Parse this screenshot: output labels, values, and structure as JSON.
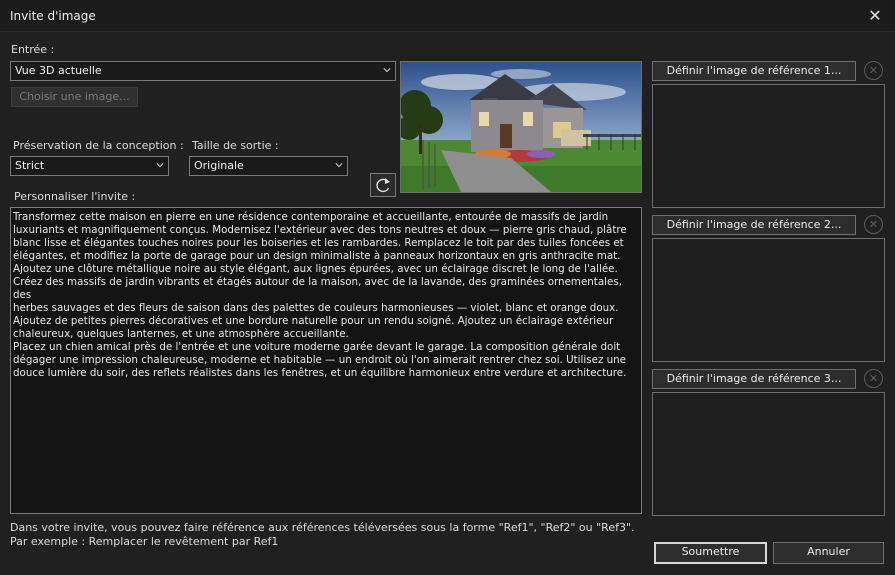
{
  "window": {
    "title": "Invite d'image",
    "close_glyph": "✕"
  },
  "input": {
    "label": "Entrée :",
    "source_value": "Vue 3D actuelle",
    "choose_image_label": "Choisir une image..."
  },
  "design_preservation": {
    "label": "Préservation de la conception :",
    "value": "Strict"
  },
  "output_size": {
    "label": "Taille de sortie :",
    "value": "Originale"
  },
  "prompt": {
    "label": "Personnaliser l'invite :",
    "text": "Transformez cette maison en pierre en une résidence contemporaine et accueillante, entourée de massifs de jardin\nluxuriants et magnifiquement conçus. Modernisez l'extérieur avec des tons neutres et doux — pierre gris chaud, plâtre\nblanc lisse et élégantes touches noires pour les boiseries et les rambardes. Remplacez le toit par des tuiles foncées et\nélégantes, et modifiez la porte de garage pour un design minimaliste à panneaux horizontaux en gris anthracite mat.\nAjoutez une clôture métallique noire au style élégant, aux lignes épurées, avec un éclairage discret le long de l'allée.\nCréez des massifs de jardin vibrants et étagés autour de la maison, avec de la lavande, des graminées ornementales, des\nherbes sauvages et des fleurs de saison dans des palettes de couleurs harmonieuses — violet, blanc et orange doux.\nAjoutez de petites pierres décoratives et une bordure naturelle pour un rendu soigné. Ajoutez un éclairage extérieur\nchaleureux, quelques lanternes, et une atmosphère accueillante.\nPlacez un chien amical près de l'entrée et une voiture moderne garée devant le garage. La composition générale doit\ndégager une impression chaleureuse, moderne et habitable — un endroit où l'on aimerait rentrer chez soi. Utilisez une\ndouce lumière du soir, des reflets réalistes dans les fenêtres, et un équilibre harmonieux entre verdure et architecture."
  },
  "help": {
    "line1": "Dans votre invite, vous pouvez faire référence aux références téléversées sous la forme \"Ref1\", \"Ref2\" ou \"Ref3\".",
    "line2": "Par exemple : Remplacer le revêtement par Ref1"
  },
  "references": [
    {
      "label": "Définir l'image de référence 1..."
    },
    {
      "label": "Définir l'image de référence 2..."
    },
    {
      "label": "Définir l'image de référence 3..."
    }
  ],
  "buttons": {
    "submit": "Soumettre",
    "cancel": "Annuler"
  },
  "icons": {
    "close": "close-icon",
    "chevron": "chevron-down-icon",
    "refresh": "refresh-icon",
    "clear": "clear-circle-icon"
  },
  "colors": {
    "background": "#202020",
    "field": "#1a1a1a",
    "border": "#7a7a7a",
    "text": "#e6e6e6"
  }
}
